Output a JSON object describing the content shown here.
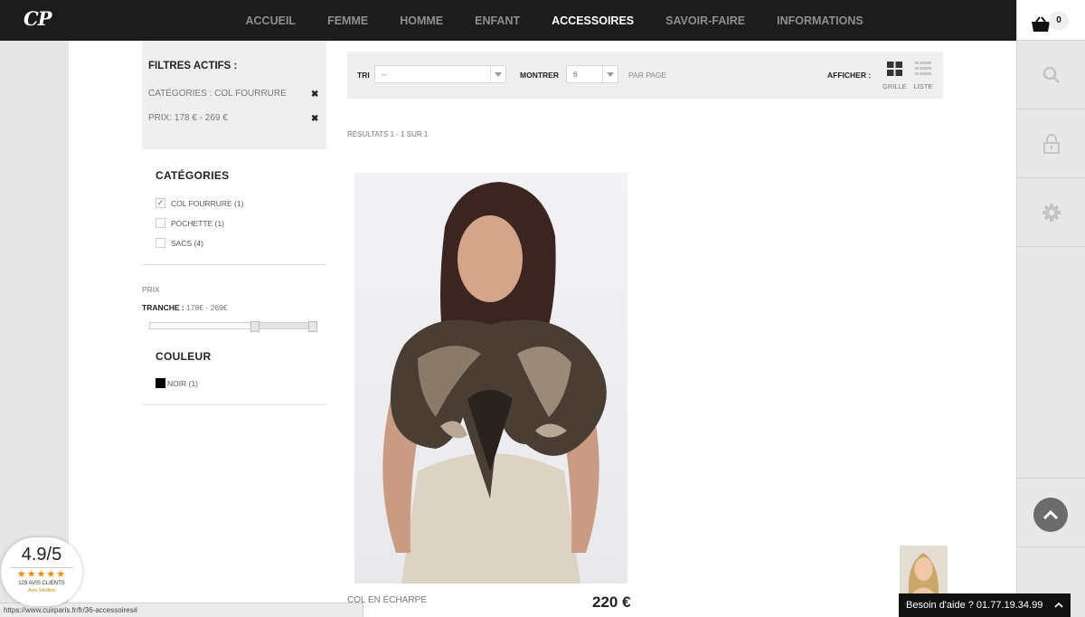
{
  "header": {
    "logo": "CP",
    "nav": [
      "ACCUEIL",
      "FEMME",
      "HOMME",
      "ENFANT",
      "ACCESSOIRES",
      "SAVOIR-FAIRE",
      "INFORMATIONS"
    ],
    "active_nav": "ACCESSOIRES"
  },
  "cart": {
    "count": "0"
  },
  "sidebar": {
    "active_filters": {
      "title": "FILTRES ACTIFS :",
      "items": [
        "CATÉGORIES : COL FOURRURE",
        "PRIX: 178 € - 269 €"
      ],
      "remove_symbol": "✖"
    },
    "categories": {
      "title": "CATÉGORIES",
      "items": [
        {
          "label": "COL FOURRURE (1)",
          "checked": true
        },
        {
          "label": "POCHETTE (1)",
          "checked": false
        },
        {
          "label": "SACS (4)",
          "checked": false
        }
      ]
    },
    "price": {
      "label": "PRIX",
      "range_label": "TRANCHE :",
      "range_value": "178€ - 269€",
      "min": 178,
      "max": 269
    },
    "color": {
      "title": "COULEUR",
      "items": [
        {
          "label": "NOIR (1)",
          "swatch": "#000000"
        }
      ]
    }
  },
  "toolbar": {
    "sort_label": "TRI",
    "sort_value": "--",
    "show_label": "MONTRER",
    "show_value": "6",
    "per_page": "PAR PAGE",
    "display_label": "AFFICHER :",
    "grid_label": "GRILLE",
    "list_label": "LISTE"
  },
  "results": "RÉSULTATS 1 - 1 SUR 1",
  "product": {
    "name": "COL EN ÉCHARPE",
    "price": "220 €"
  },
  "status_url": "https://www.cuirparis.fr/fr/36-accessoires#",
  "rating": {
    "score": "4.9/5",
    "stars": "★★★★★",
    "count": "129 AVIS CLIENTS",
    "brand": "Avis Vérifiés"
  },
  "chat": {
    "text": "Besoin d'aide ? 01.77.19.34.99"
  },
  "colors": {
    "header_bg": "#1c1c1c",
    "nav_active": "#ffffff",
    "nav_inactive": "#8f8f8f",
    "panel_bg": "#efefef"
  }
}
